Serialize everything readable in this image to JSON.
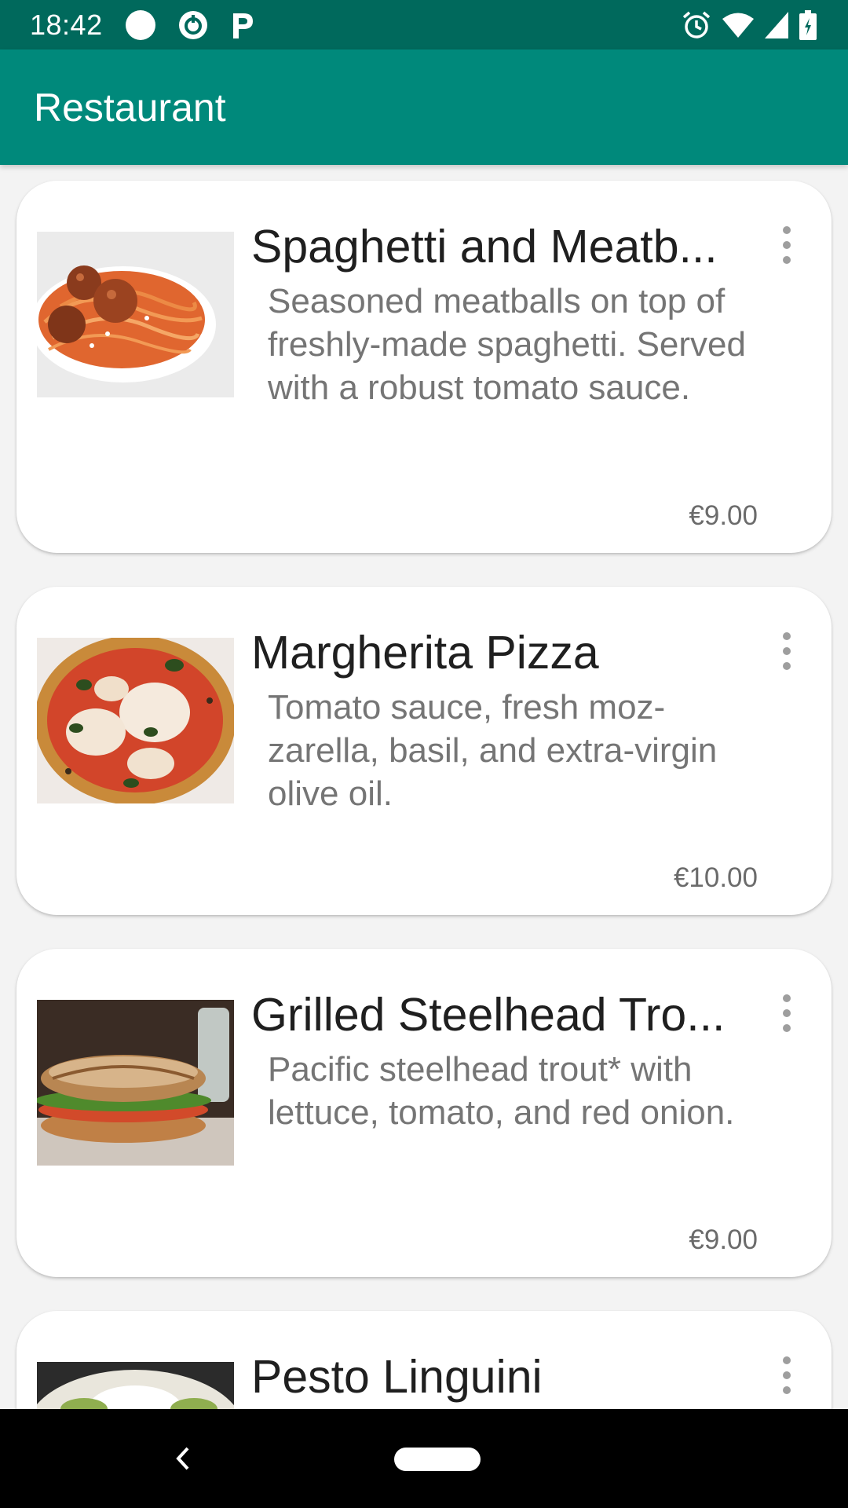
{
  "status_bar": {
    "time": "18:42",
    "left_icons": [
      "circle-notification-icon",
      "sync-icon",
      "parking-icon"
    ],
    "right_icons": [
      "alarm-icon",
      "wifi-icon",
      "signal-icon",
      "battery-icon"
    ]
  },
  "app_bar": {
    "title": "Restaurant",
    "color": "#00897b",
    "status_color": "#00695c"
  },
  "menu_items": [
    {
      "name": "Spaghetti and Meatb...",
      "description": "Seasoned meatballs on top of freshly-made spaghetti. Served with a robust tomato sauce.",
      "price": "€9.00",
      "photo_icon": "spaghetti-photo"
    },
    {
      "name": "Margherita Pizza",
      "description": "Tomato sauce, fresh moz- zarella, basil, and extra-virgin olive oil.",
      "price": "€10.00",
      "photo_icon": "pizza-photo"
    },
    {
      "name": "Grilled Steelhead Tro...",
      "description": "Pacific steelhead trout* with lettuce, tomato, and red onion.",
      "price": "€9.00",
      "photo_icon": "sandwich-photo"
    },
    {
      "name": "Pesto Linguini",
      "description": "",
      "price": "",
      "photo_icon": "pesto-photo"
    }
  ],
  "nav_bar": {
    "back_icon": "back-icon",
    "home_icon": "home-pill-icon"
  }
}
